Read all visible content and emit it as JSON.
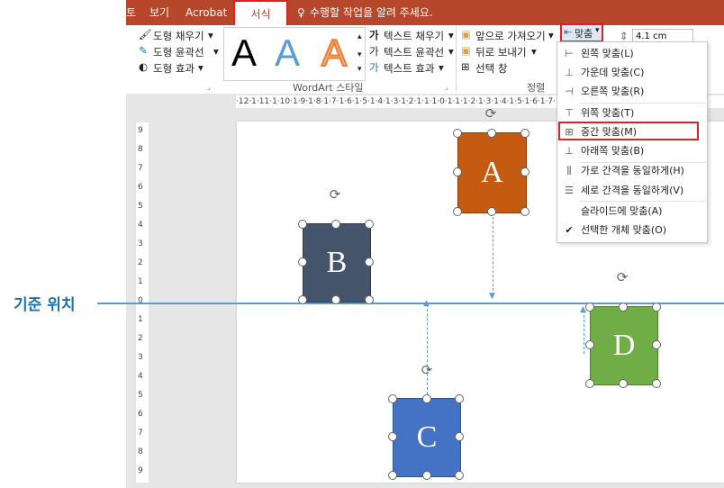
{
  "tabs": {
    "t1": "토",
    "t2": "보기",
    "t3": "Acrobat",
    "active": "서식",
    "tell_me": "수행할 작업을 알려 주세요."
  },
  "shape_styles": {
    "fill": "도형 채우기",
    "outline": "도형 윤곽선",
    "effects": "도형 효과"
  },
  "wordart": {
    "letters": [
      "A",
      "A",
      "A"
    ],
    "text_fill": "텍스트 채우기",
    "text_outline": "텍스트 윤곽선",
    "text_effects": "텍스트 효과",
    "group_label": "WordArt 스타일"
  },
  "arrange": {
    "bring_forward": "앞으로 가져오기",
    "send_backward": "뒤로 보내기",
    "selection_pane": "선택 창",
    "group_label": "정렬",
    "align_button": "맞춤"
  },
  "size": {
    "height_value": "4.1 cm"
  },
  "ruler": {
    "horizontal": "·12·1·11·1·10·1·9·1·8·1·7·1·6·1·5·1·4·1·3·1·2·1·1·1·0·1·1·1·2·1·3·1·4·1·5·1·6·1·7·1·8·1·9·1·10·1·11·1·12·",
    "vertical": [
      "9",
      "8",
      "7",
      "6",
      "5",
      "4",
      "3",
      "2",
      "1",
      "0",
      "1",
      "2",
      "3",
      "4",
      "5",
      "6",
      "7",
      "8",
      "9"
    ]
  },
  "align_menu": {
    "items": [
      "왼쪽 맞춤(L)",
      "가운데 맞춤(C)",
      "오른쪽 맞춤(R)",
      "위쪽 맞춤(T)",
      "중간 맞춤(M)",
      "아래쪽 맞춤(B)",
      "가로 간격을 동일하게(H)",
      "세로 간격을 동일하게(V)",
      "슬라이드에 맞춤(A)",
      "선택한 개체 맞춤(O)"
    ]
  },
  "shapes": {
    "a": {
      "label": "A",
      "color": "#c55a11"
    },
    "b": {
      "label": "B",
      "color": "#44546a"
    },
    "c": {
      "label": "C",
      "color": "#4472c4"
    },
    "d": {
      "label": "D",
      "color": "#70ad47"
    }
  },
  "annotation": {
    "baseline_label": "기준 위치"
  },
  "colors": {
    "tab_bar": "#b7472a",
    "highlight": "#e02020",
    "guide_line": "#5b9bd5"
  }
}
